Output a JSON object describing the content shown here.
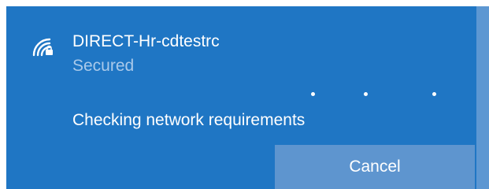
{
  "network": {
    "icon": "wifi-secured-icon",
    "name": "DIRECT-Hr-cdtestrc",
    "status": "Secured"
  },
  "progress": {
    "message": "Checking network requirements",
    "indicator": "dots"
  },
  "actions": {
    "cancel_label": "Cancel"
  },
  "colors": {
    "panel": "#1f76c4",
    "button": "#5e95cf",
    "edge": "#5d97d2",
    "secondary_text": "#a9c9ea"
  }
}
